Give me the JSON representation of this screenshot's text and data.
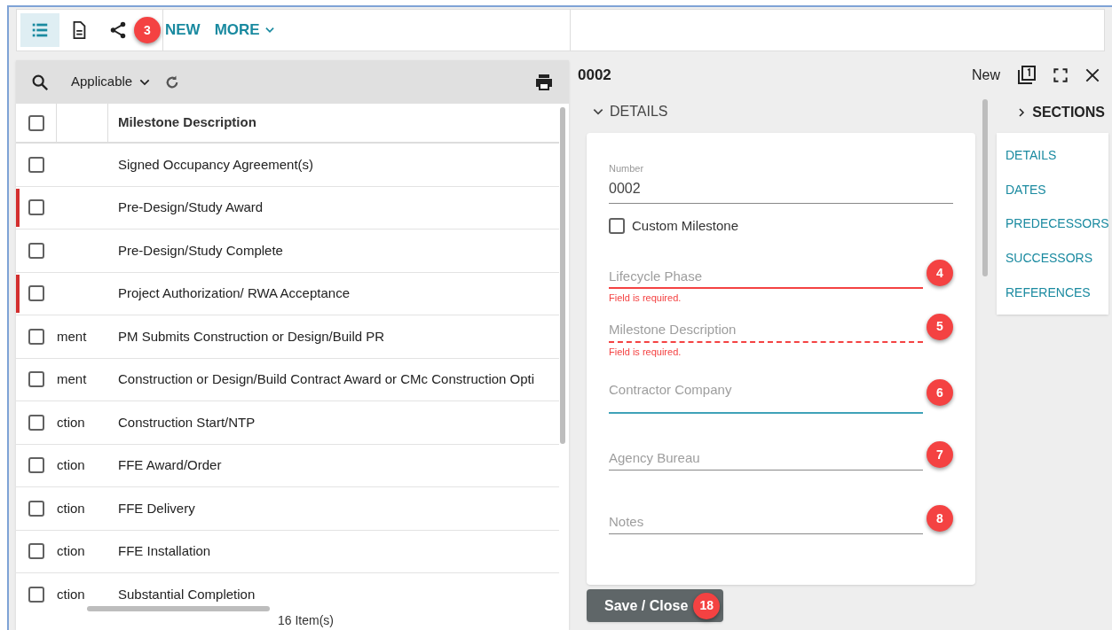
{
  "toolbar": {
    "views": [
      {
        "kind": "list",
        "selected": true
      },
      {
        "kind": "document",
        "selected": false
      },
      {
        "kind": "share",
        "selected": false
      }
    ],
    "share_badge": "3",
    "new": "NEW",
    "more": "MORE"
  },
  "list": {
    "filter": "Applicable",
    "select_all": false,
    "columns": [
      "Milestone Description"
    ],
    "rows": [
      {
        "flagged": false,
        "checked": false,
        "column_2": "",
        "description": "Signed Occupancy Agreement(s)"
      },
      {
        "flagged": true,
        "checked": false,
        "column_2": "",
        "description": "Pre-Design/Study Award"
      },
      {
        "flagged": false,
        "checked": false,
        "column_2": "",
        "description": "Pre-Design/Study Complete"
      },
      {
        "flagged": true,
        "checked": false,
        "column_2": "",
        "description": "Project Authorization/ RWA Acceptance"
      },
      {
        "flagged": false,
        "checked": false,
        "column_2": "ment",
        "description": "PM Submits Construction or Design/Build PR"
      },
      {
        "flagged": false,
        "checked": false,
        "column_2": "ment",
        "description": "Construction or Design/Build Contract Award or CMc Construction Opti"
      },
      {
        "flagged": false,
        "checked": false,
        "column_2": "ction",
        "description": "Construction Start/NTP"
      },
      {
        "flagged": false,
        "checked": false,
        "column_2": "ction",
        "description": "FFE Award/Order"
      },
      {
        "flagged": false,
        "checked": false,
        "column_2": "ction",
        "description": "FFE Delivery"
      },
      {
        "flagged": false,
        "checked": false,
        "column_2": "ction",
        "description": "FFE Installation"
      },
      {
        "flagged": false,
        "checked": false,
        "column_2": "ction",
        "description": "Substantial Completion"
      }
    ],
    "item_count": "16 Item(s)"
  },
  "detail": {
    "title": "0002",
    "status": "New",
    "section": "DETAILS",
    "number": {
      "label": "Number",
      "value": "0002"
    },
    "custom_milestone": {
      "label": "Custom Milestone",
      "checked": false
    },
    "fields": [
      {
        "placeholder": "Lifecycle Phase",
        "kind": "error",
        "error": "Field is required.",
        "badge": "4"
      },
      {
        "placeholder": "Milestone Description",
        "kind": "error_dashed",
        "error": "Field is required.",
        "badge": "5"
      },
      {
        "placeholder": "Contractor Company",
        "kind": "focused",
        "badge": "6"
      },
      {
        "placeholder": "Agency Bureau",
        "kind": "normal",
        "badge": "7"
      },
      {
        "placeholder": "Notes",
        "kind": "normal",
        "badge": "8"
      }
    ],
    "save": "Save / Close",
    "save_badge": "18"
  },
  "sections": {
    "heading": "SECTIONS",
    "items": [
      "DETAILS",
      "DATES",
      "PREDECESSORS",
      "SUCCESSORS",
      "REFERENCES"
    ]
  }
}
